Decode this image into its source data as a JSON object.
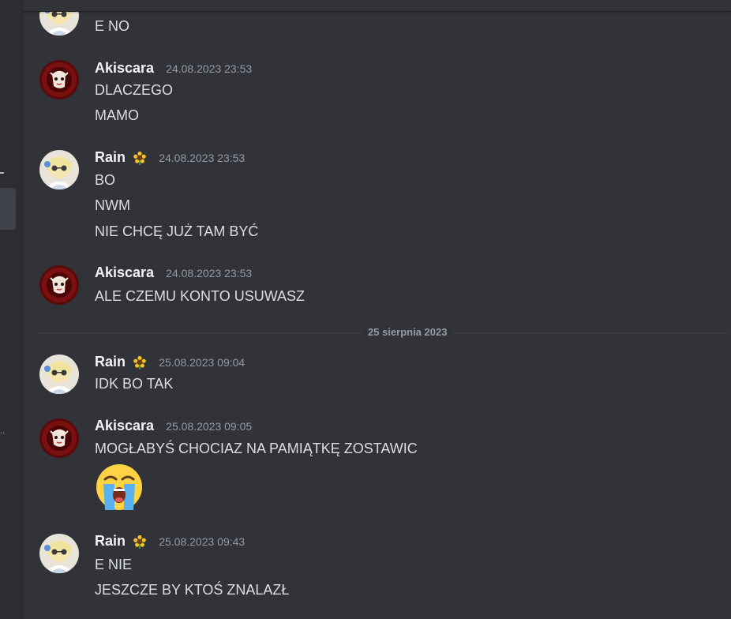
{
  "date_divider": "25 sierpnia 2023",
  "colors": {
    "background": "#313338",
    "rail": "#2b2d31",
    "author": "#f2f3f5",
    "text": "#dbdee1",
    "muted": "#949ba4"
  },
  "partial_message": {
    "line": "E NO",
    "avatar_icon": "rain-avatar"
  },
  "groups": [
    {
      "author": "Akiscara",
      "timestamp": "24.08.2023 23:53",
      "avatar_icon": "akiscara-avatar",
      "lines": [
        "DLACZEGO",
        "MAMO"
      ]
    },
    {
      "author": "Rain",
      "timestamp": "24.08.2023 23:53",
      "avatar_icon": "rain-avatar",
      "badge": "sunflower-icon",
      "lines": [
        "BO",
        "NWM",
        "NIE CHCĘ JUŻ TAM BYĆ"
      ]
    },
    {
      "author": "Akiscara",
      "timestamp": "24.08.2023 23:53",
      "avatar_icon": "akiscara-avatar",
      "lines": [
        "ALE CZEMU KONTO USUWASZ"
      ]
    },
    {
      "author": "Rain",
      "timestamp": "25.08.2023 09:04",
      "avatar_icon": "rain-avatar",
      "badge": "sunflower-icon",
      "lines": [
        "IDK BO TAK"
      ]
    },
    {
      "author": "Akiscara",
      "timestamp": "25.08.2023 09:05",
      "avatar_icon": "akiscara-avatar",
      "lines": [
        "MOGŁABYŚ CHOCIAZ NA PAMIĄTKĘ ZOSTAWIC"
      ],
      "emoji": "loudly-crying-face-emoji"
    },
    {
      "author": "Rain",
      "timestamp": "25.08.2023 09:43",
      "avatar_icon": "rain-avatar",
      "badge": "sunflower-icon",
      "lines": [
        "E NIE",
        "JESZCZE BY KTOŚ ZNALAZŁ"
      ]
    }
  ]
}
